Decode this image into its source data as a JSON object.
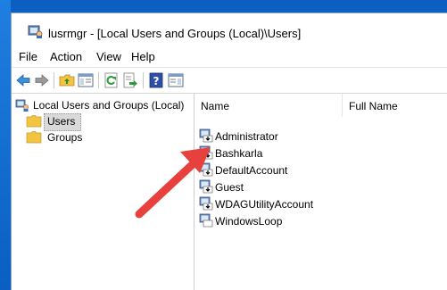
{
  "window": {
    "title": "lusrmgr - [Local Users and Groups (Local)\\Users]"
  },
  "menu": {
    "items": [
      "File",
      "Action",
      "View",
      "Help"
    ]
  },
  "toolbar": {
    "buttons": [
      "back-icon",
      "forward-icon",
      "up-folder-icon",
      "show-hide-tree-icon",
      "refresh-icon",
      "export-list-icon",
      "help-icon",
      "show-hide-action-pane-icon"
    ]
  },
  "tree": {
    "root": "Local Users and Groups (Local)",
    "items": [
      {
        "label": "Users",
        "selected": true
      },
      {
        "label": "Groups",
        "selected": false
      }
    ]
  },
  "list": {
    "columns": [
      "Name",
      "Full Name"
    ],
    "rows": [
      {
        "name": "Administrator",
        "full_name": ""
      },
      {
        "name": "Bashkarla",
        "full_name": ""
      },
      {
        "name": "DefaultAccount",
        "full_name": ""
      },
      {
        "name": "Guest",
        "full_name": ""
      },
      {
        "name": "WDAGUtilityAccount",
        "full_name": ""
      },
      {
        "name": "WindowsLoop",
        "full_name": ""
      }
    ]
  },
  "annotation": {
    "arrow_color": "#e8413d"
  },
  "colors": {
    "desktop": "#0a5fc0",
    "selection": "#d9d9d9",
    "folder": "#f3c443"
  }
}
